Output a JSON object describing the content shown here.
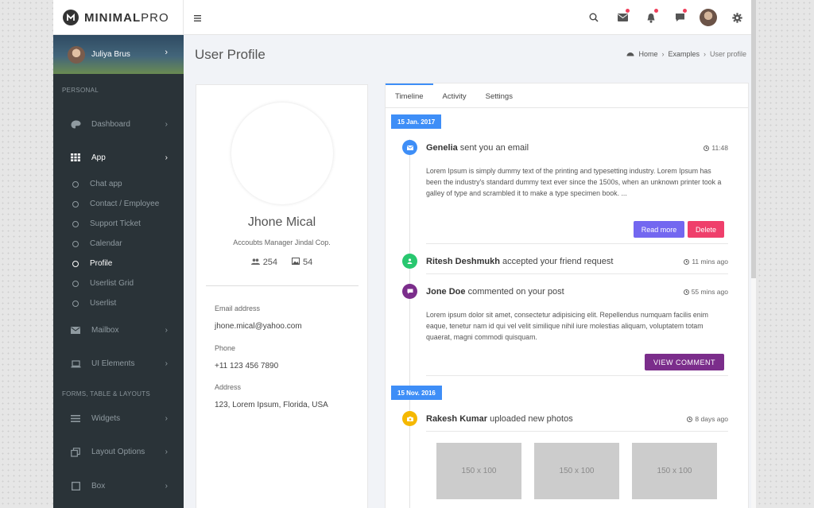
{
  "app": {
    "logo_bold": "MINIMAL",
    "logo_light": "PRO"
  },
  "sidebar": {
    "user_name": "Juliya Brus",
    "sections": [
      "PERSONAL",
      "FORMS, TABLE & LAYOUTS"
    ],
    "items": [
      {
        "label": "Dashboard",
        "icon": "palette-icon"
      },
      {
        "label": "App",
        "icon": "grid-icon"
      },
      {
        "label": "Mailbox",
        "icon": "mail-icon"
      },
      {
        "label": "UI Elements",
        "icon": "laptop-icon"
      },
      {
        "label": "Widgets",
        "icon": "bars-icon"
      },
      {
        "label": "Layout Options",
        "icon": "copy-icon"
      },
      {
        "label": "Box",
        "icon": "square-icon"
      }
    ],
    "sub_items": [
      "Chat app",
      "Contact / Employee",
      "Support Ticket",
      "Calendar",
      "Profile",
      "Userlist Grid",
      "Userlist"
    ]
  },
  "header": {
    "title": "User Profile",
    "breadcrumb": [
      "Home",
      "Examples",
      "User profile"
    ]
  },
  "profile": {
    "name": "Jhone Mical",
    "role": "Accoubts Manager Jindal Cop.",
    "followers": "254",
    "photos": "54",
    "email_label": "Email address",
    "email": "jhone.mical@yahoo.com",
    "phone_label": "Phone",
    "phone": "+11 123 456 7890",
    "address_label": "Address",
    "address": "123, Lorem Ipsum, Florida, USA"
  },
  "tabs": [
    "Timeline",
    "Activity",
    "Settings"
  ],
  "timeline": {
    "date1": "15 Jan. 2017",
    "date2": "15 Nov. 2016",
    "items": [
      {
        "name": "Genelia",
        "action": " sent you an email",
        "time": "11:48",
        "body": "Lorem Ipsum is simply dummy text of the printing and typesetting industry. Lorem Ipsum has been the industry's standard dummy text ever since the 1500s, when an unknown printer took a galley of type and scrambled it to make a type specimen book. ...",
        "color": "#3e8ef7"
      },
      {
        "name": "Ritesh Deshmukh",
        "action": " accepted your friend request",
        "time": "11 mins ago",
        "color": "#28c76f"
      },
      {
        "name": "Jone Doe",
        "action": " commented on your post",
        "time": "55 mins ago",
        "body": "Lorem ipsum dolor sit amet, consectetur adipisicing elit. Repellendus numquam facilis enim eaque, tenetur nam id qui vel velit similique nihil iure molestias aliquam, voluptatem totam quaerat, magni commodi quisquam.",
        "color": "#7b2d8b"
      },
      {
        "name": "Rakesh Kumar",
        "action": " uploaded new photos",
        "time": "8 days ago",
        "color": "#f5b800"
      }
    ],
    "read_more": "Read more",
    "delete": "Delete",
    "view_comment": "VIEW COMMENT",
    "photo_label": "150 x 100"
  }
}
